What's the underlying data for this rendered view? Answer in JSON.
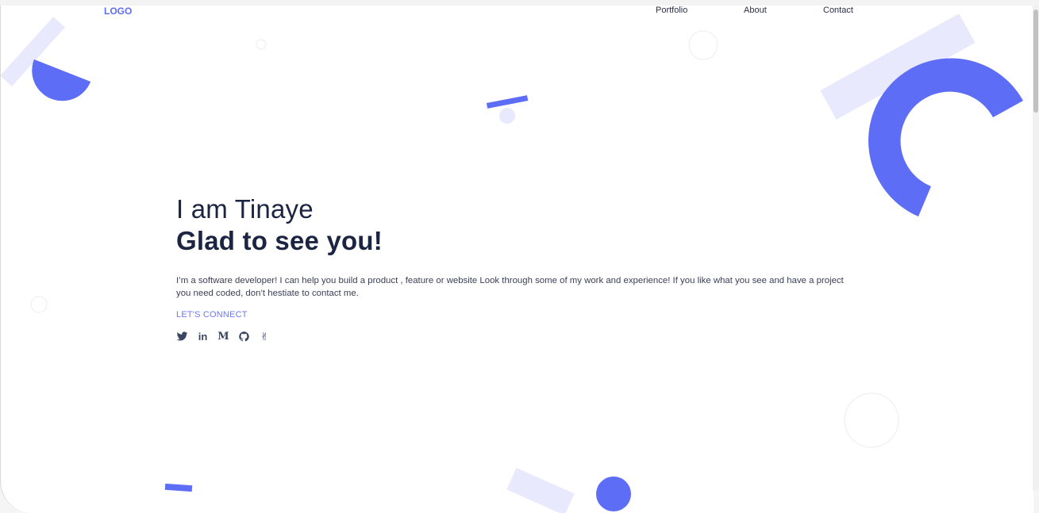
{
  "nav": {
    "logo": "LOGO",
    "links": [
      "Portfolio",
      "About",
      "Contact"
    ]
  },
  "hero": {
    "title_line1": "I am Tinaye",
    "title_line2": "Glad to see you!",
    "description": "I’m a software developer! I can help you build a product , feature or website Look through some of my work and experience! If you like what you see and have a project you need coded, don’t hestiate to contact me.",
    "cta": "LET'S CONNECT"
  },
  "socials": [
    {
      "name": "twitter",
      "icon": "twitter-icon"
    },
    {
      "name": "linkedin",
      "icon": "linkedin-icon",
      "glyph": "in"
    },
    {
      "name": "medium",
      "icon": "medium-icon",
      "glyph": "M"
    },
    {
      "name": "github",
      "icon": "github-icon"
    },
    {
      "name": "angellist",
      "icon": "angellist-icon",
      "glyph": "✌"
    }
  ],
  "colors": {
    "accent": "#5d6df6",
    "accent_light": "#e8e9fd",
    "text_dark": "#1b2440",
    "text_body": "#3a3f55",
    "link": "#6b78f7"
  }
}
